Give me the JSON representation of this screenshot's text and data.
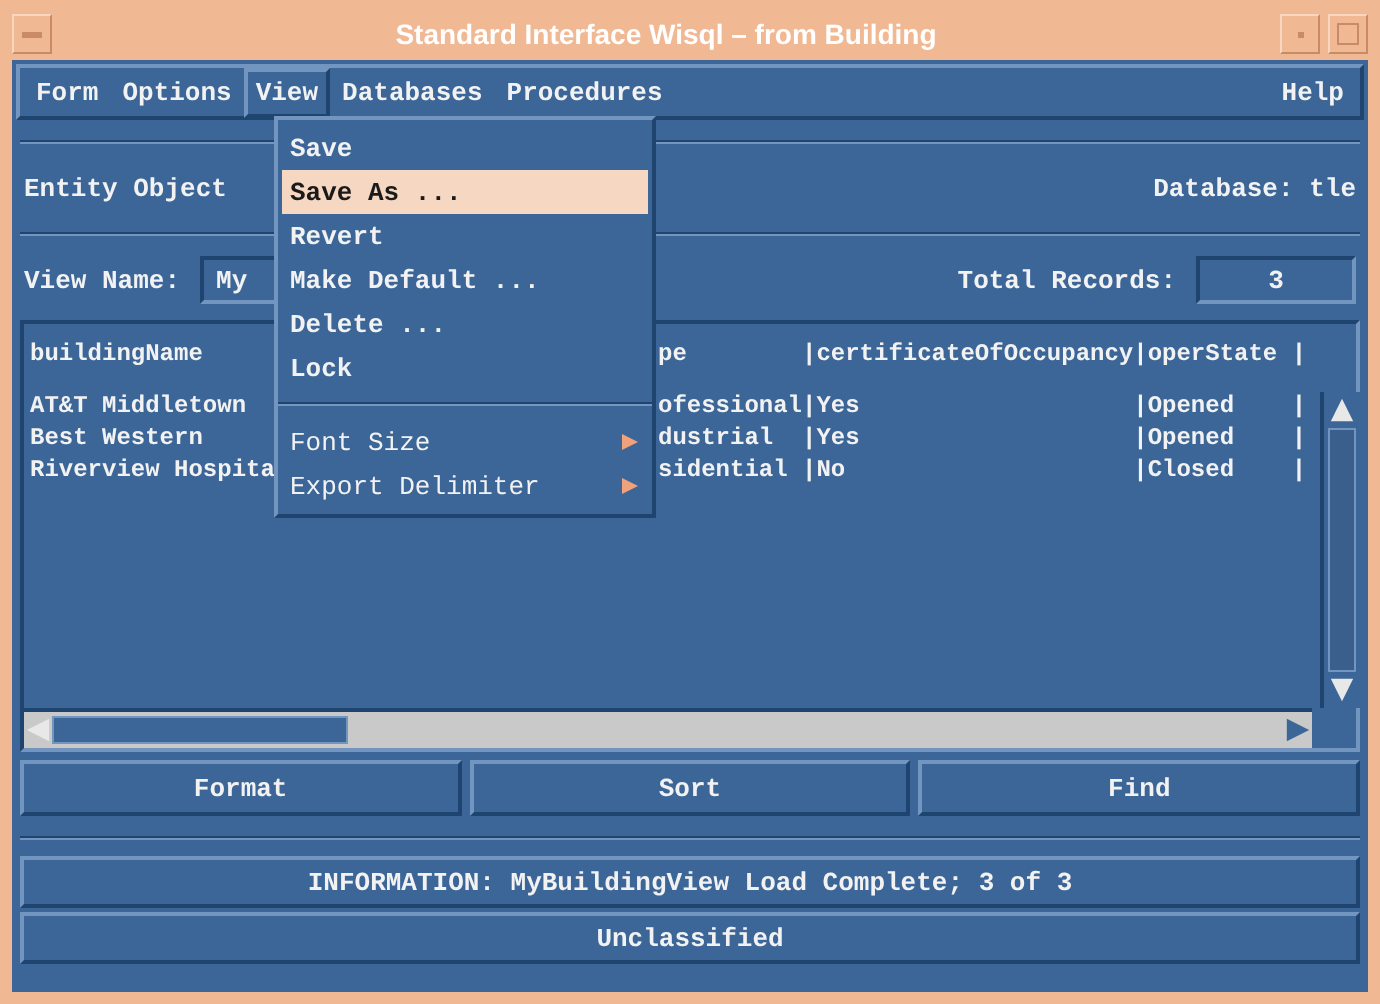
{
  "window": {
    "title": "Standard Interface Wisql – from Building"
  },
  "menubar": {
    "items": [
      {
        "label": "Form",
        "selected": false
      },
      {
        "label": "Options",
        "selected": false
      },
      {
        "label": "View",
        "selected": true
      },
      {
        "label": "Databases",
        "selected": false
      },
      {
        "label": "Procedures",
        "selected": false
      }
    ],
    "right_items": [
      {
        "label": "Help",
        "selected": false
      }
    ]
  },
  "view_menu": {
    "items": [
      {
        "kind": "item",
        "label": "Save",
        "selected": false
      },
      {
        "kind": "item",
        "label": "Save As ...",
        "selected": true
      },
      {
        "kind": "item",
        "label": "Revert",
        "selected": false
      },
      {
        "kind": "item",
        "label": "Make Default ...",
        "selected": false
      },
      {
        "kind": "item",
        "label": "Delete ...",
        "selected": false
      },
      {
        "kind": "item",
        "label": "Lock",
        "selected": false
      },
      {
        "kind": "separator"
      },
      {
        "kind": "submenu",
        "label": "Font Size",
        "selected": false
      },
      {
        "kind": "submenu",
        "label": "Export Delimiter",
        "selected": false
      }
    ]
  },
  "entity": {
    "label": "Entity Object"
  },
  "database": {
    "label": "Database:",
    "value": "tle"
  },
  "view_name": {
    "label": "View Name:",
    "value": "My"
  },
  "total_records": {
    "label": "Total Records:",
    "value": "3"
  },
  "table": {
    "columns": [
      "buildingName",
      "pe",
      "|certificateOfOccupancy",
      "|operState",
      "|"
    ],
    "rows": [
      [
        "AT&T Middletown",
        "ofessional",
        "|Yes",
        "|Opened",
        "|"
      ],
      [
        "Best Western",
        "dustrial",
        "|Yes",
        "|Opened",
        "|"
      ],
      [
        "Riverview Hospita",
        "sidential",
        "|No",
        "|Closed",
        "|"
      ]
    ]
  },
  "buttons": [
    "Format",
    "Sort",
    "Find"
  ],
  "information": "INFORMATION: MyBuildingView Load Complete; 3 of 3",
  "classification": "Unclassified"
}
